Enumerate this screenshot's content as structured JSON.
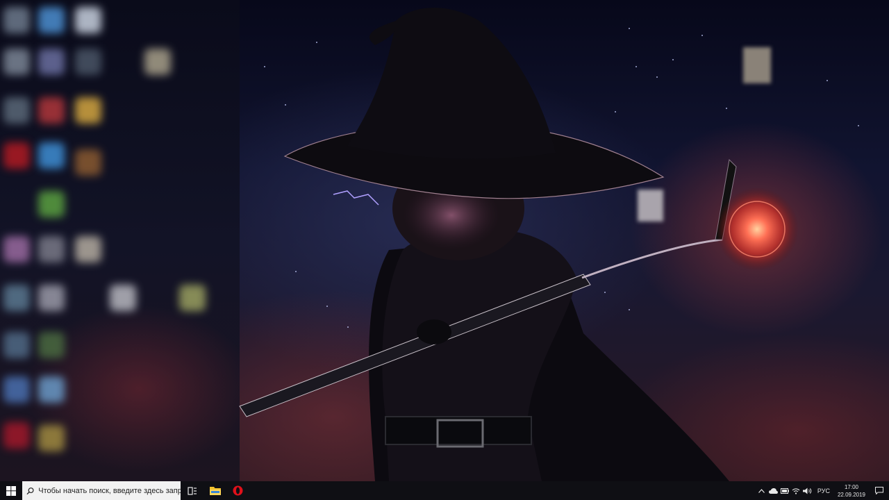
{
  "taskbar": {
    "search_placeholder": "Чтобы начать поиск, введите здесь запрос",
    "start_icon": "windows-logo-icon",
    "pinned": [
      {
        "name": "task-view-icon"
      },
      {
        "name": "file-explorer-icon"
      },
      {
        "name": "opera-browser-icon"
      }
    ],
    "tray": {
      "language": "РУС",
      "time": "17:00",
      "date": "22.09.2019"
    }
  },
  "colors": {
    "taskbar_bg": "#0f0f14",
    "search_bg": "#f2f2f2",
    "opera_red": "#e0101a",
    "explorer_yellow": "#f2c12e",
    "windows_white": "#ffffff"
  }
}
